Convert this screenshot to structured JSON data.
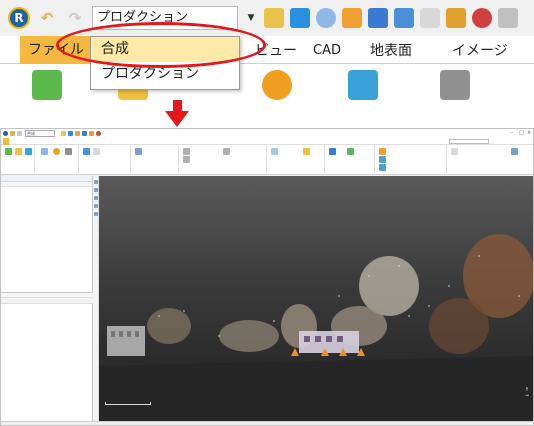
{
  "zoom_inset": {
    "quick_access": {
      "combo_value": "プロダクション"
    },
    "ribbon_tabs": {
      "file": "ファイル",
      "view_partial": "ビュー",
      "cad": "CAD",
      "terrain": "地表面",
      "image": "イメージ"
    },
    "dropdown": {
      "items": [
        "合成",
        "プロダクション"
      ]
    }
  },
  "app": {
    "title_bar": {
      "combo_value": "合成"
    },
    "colors": {
      "accent_file_tab": "#f4b740",
      "highlight_circle": "#e4171b",
      "viewport_top": "#5a5a5a",
      "viewport_bottom": "#202020"
    }
  }
}
